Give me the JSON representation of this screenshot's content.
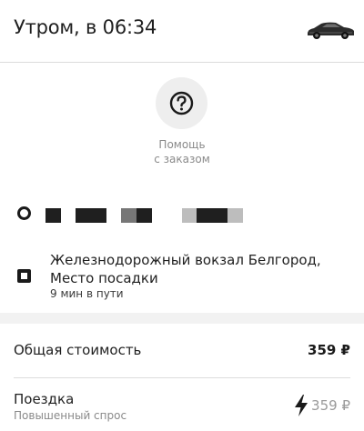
{
  "header": {
    "title": "Утром, в 06:34",
    "car_icon": "car-icon"
  },
  "help": {
    "label_line1": "Помощь",
    "label_line2": "с заказом",
    "icon": "question-icon"
  },
  "route": {
    "destination": "Железнодорожный вокзал Белгород, Место посадки",
    "eta": "9 мин в пути"
  },
  "summary": {
    "total_label": "Общая стоимость",
    "total_value": "359 ₽",
    "trip_label": "Поездка",
    "trip_sub": "Повышенный спрос",
    "trip_price": "359 ₽",
    "surge_icon": "lightning-icon"
  },
  "colors": {
    "text": "#1f1f1f",
    "muted": "#8a8a8a",
    "circle": "#eeeeee"
  }
}
